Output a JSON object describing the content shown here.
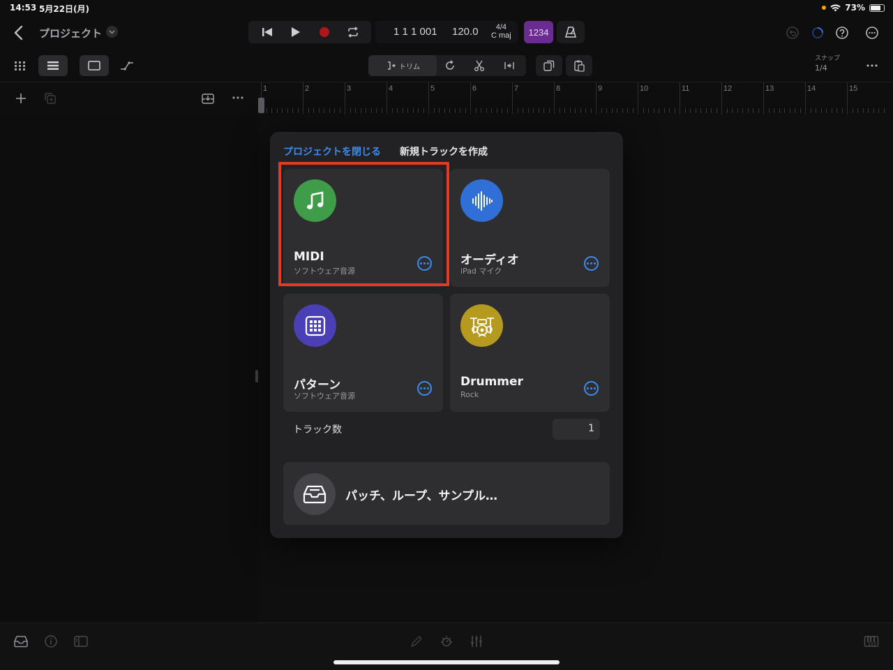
{
  "status": {
    "time": "14:53",
    "date": "5月22日(月)",
    "battery": "73%"
  },
  "header": {
    "title": "プロジェクト"
  },
  "lcd": {
    "position": "1 1 1 001",
    "tempo": "120.0",
    "time_signature": "4/4",
    "key": "C maj"
  },
  "count_in": "1234",
  "toolbar": {
    "trim_label": "トリム",
    "snap_label": "スナップ",
    "snap_value": "1/4"
  },
  "ruler": {
    "bars": [
      "1",
      "2",
      "3",
      "4",
      "5",
      "6",
      "7",
      "8",
      "9",
      "10",
      "11",
      "12",
      "13",
      "14",
      "15"
    ]
  },
  "dialog": {
    "close_label": "プロジェクトを閉じる",
    "title": "新規トラックを作成",
    "cards": [
      {
        "title": "MIDI",
        "subtitle": "ソフトウェア音源",
        "icon": "music-note-icon",
        "color": "#3f9d49"
      },
      {
        "title": "オーディオ",
        "subtitle": "iPad マイク",
        "icon": "waveform-icon",
        "color": "#2f6fd6"
      },
      {
        "title": "パターン",
        "subtitle": "ソフトウェア音源",
        "icon": "pattern-grid-icon",
        "color": "#4a3fb5"
      },
      {
        "title": "Drummer",
        "subtitle": "Rock",
        "icon": "drum-kit-icon",
        "color": "#b59a1f"
      }
    ],
    "track_count_label": "トラック数",
    "track_count_value": "1",
    "browse_label": "パッチ、ループ、サンプル…"
  },
  "colors": {
    "accent": "#3a8cf0",
    "highlight": "#e13c22"
  }
}
